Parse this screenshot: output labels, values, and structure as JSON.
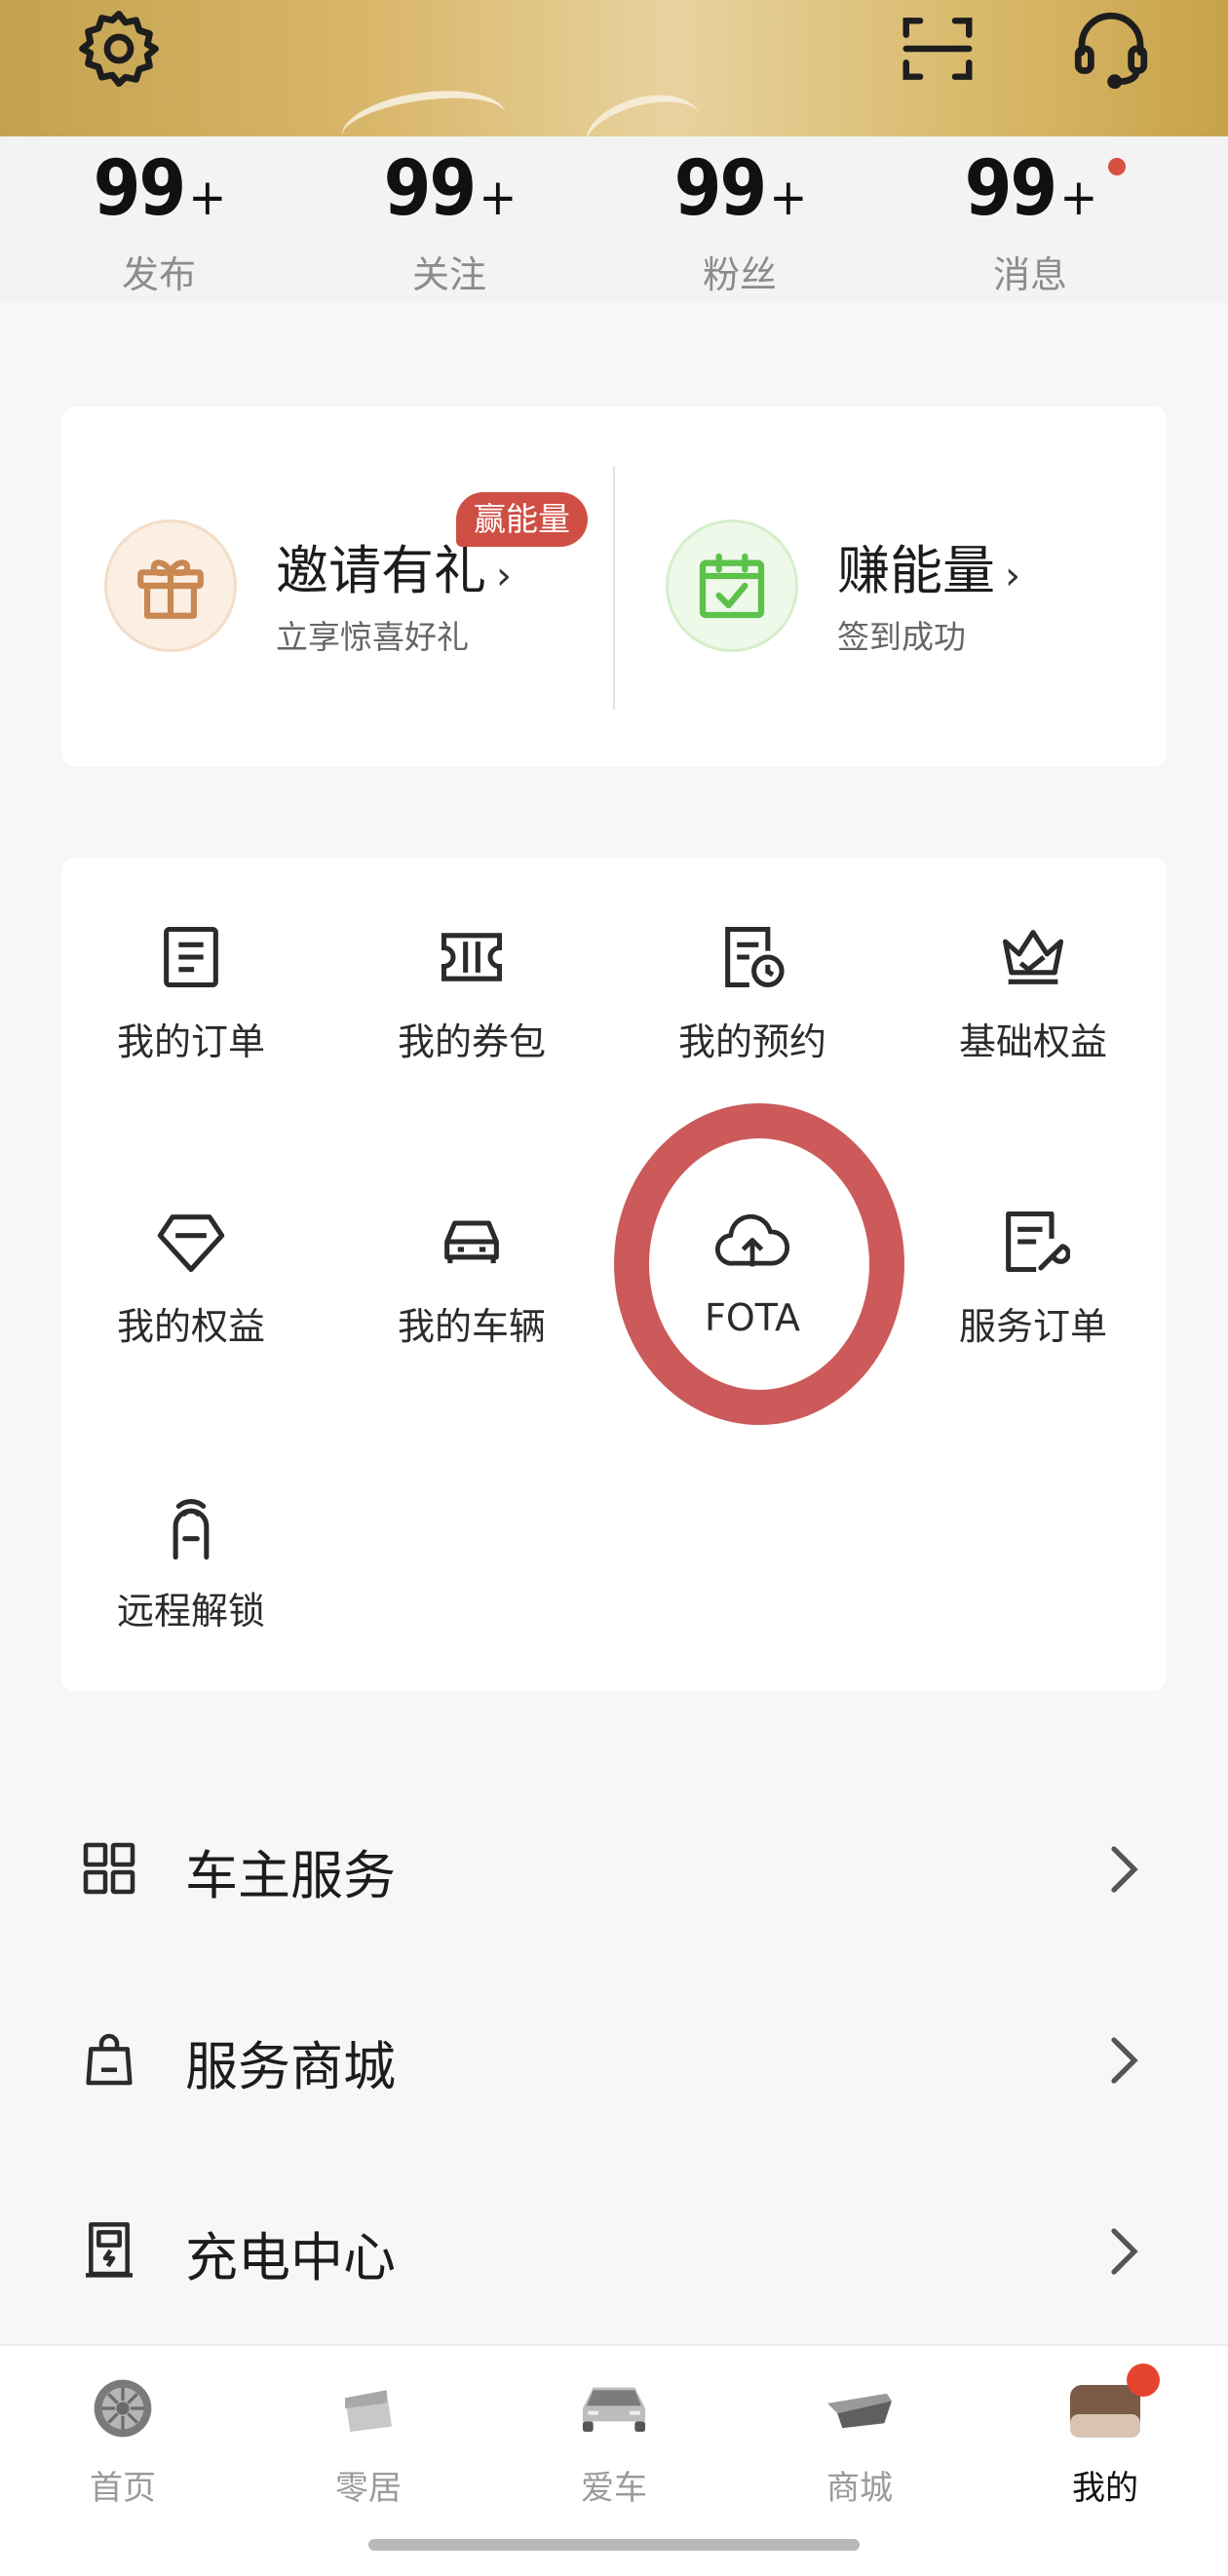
{
  "header": {
    "settings_icon": "gear-icon",
    "scan_icon": "scan-icon",
    "service_icon": "headset-icon",
    "banner_color": "#d9b76a"
  },
  "stats": [
    {
      "value": "99",
      "plus": "+",
      "label": "发布"
    },
    {
      "value": "99",
      "plus": "+",
      "label": "关注"
    },
    {
      "value": "99",
      "plus": "+",
      "label": "粉丝"
    },
    {
      "value": "99",
      "plus": "+",
      "label": "消息"
    }
  ],
  "promo": {
    "invite": {
      "title": "邀请有礼",
      "subtitle": "立享惊喜好礼",
      "badge": "赢能量",
      "icon": "gift-icon"
    },
    "earn": {
      "title": "赚能量",
      "subtitle": "签到成功",
      "icon": "calendar-check-icon"
    }
  },
  "grid": [
    {
      "label": "我的订单",
      "icon": "order-icon"
    },
    {
      "label": "我的券包",
      "icon": "coupon-icon"
    },
    {
      "label": "我的预约",
      "icon": "appointment-icon"
    },
    {
      "label": "基础权益",
      "icon": "crown-icon"
    },
    {
      "label": "我的权益",
      "icon": "diamond-icon"
    },
    {
      "label": "我的车辆",
      "icon": "car-icon"
    },
    {
      "label": "FOTA",
      "icon": "cloud-upload-icon"
    },
    {
      "label": "服务订单",
      "icon": "service-order-icon"
    },
    {
      "label": "远程解锁",
      "icon": "remote-unlock-icon"
    }
  ],
  "list": [
    {
      "label": "车主服务",
      "icon": "grid-icon"
    },
    {
      "label": "服务商城",
      "icon": "shopping-bag-icon"
    },
    {
      "label": "充电中心",
      "icon": "charger-icon"
    }
  ],
  "tabs": [
    {
      "label": "首页",
      "icon": "wheel-icon"
    },
    {
      "label": "零居",
      "icon": "home-icon"
    },
    {
      "label": "爱车",
      "icon": "car-front-icon"
    },
    {
      "label": "商城",
      "icon": "mall-icon"
    },
    {
      "label": "我的",
      "icon": "profile-icon"
    }
  ],
  "colors": {
    "accent_red": "#cf4f45",
    "highlight": "#cc5a5b",
    "green": "#5cc24a",
    "orange": "#c98751"
  }
}
